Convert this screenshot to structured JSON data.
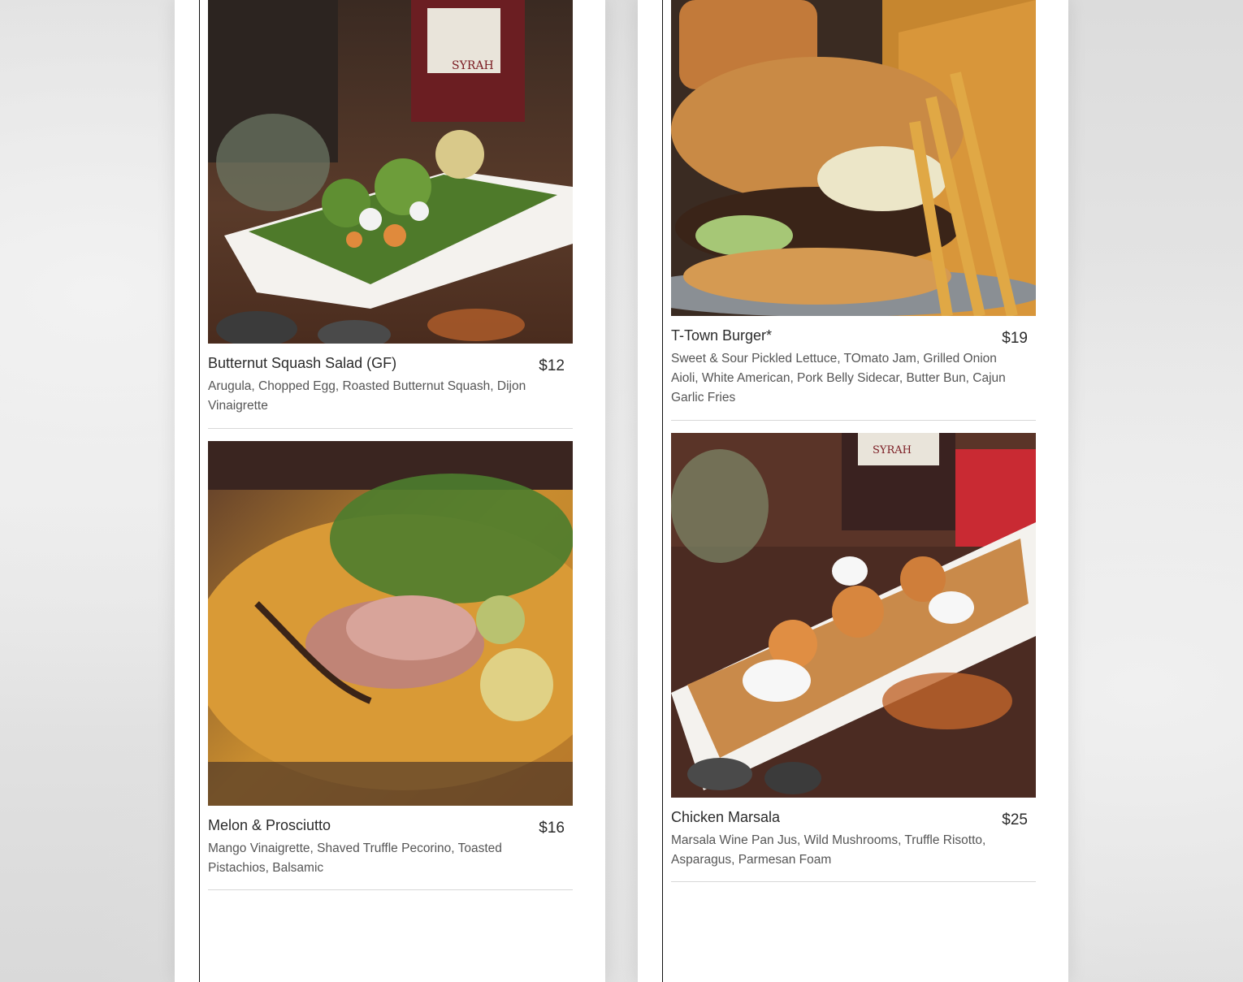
{
  "menu": {
    "items": [
      {
        "name": "Butternut Squash Salad (GF)",
        "price": "$12",
        "description": "Arugula, Chopped Egg, Roasted Butternut Squash, Dijon Vinaigrette"
      },
      {
        "name": "Melon & Prosciutto",
        "price": "$16",
        "description": "Mango Vinaigrette, Shaved Truffle Pecorino, Toasted Pistachios, Balsamic"
      },
      {
        "name": "T-Town Burger*",
        "price": "$19",
        "description": "Sweet & Sour Pickled Lettuce, TOmato Jam, Grilled Onion Aioli, White American, Pork Belly Sidecar, Butter Bun, Cajun Garlic Fries"
      },
      {
        "name": "Chicken Marsala",
        "price": "$25",
        "description": "Marsala Wine Pan Jus, Wild Mushrooms, Truffle Risotto, Asparagus, Parmesan Foam"
      }
    ]
  }
}
